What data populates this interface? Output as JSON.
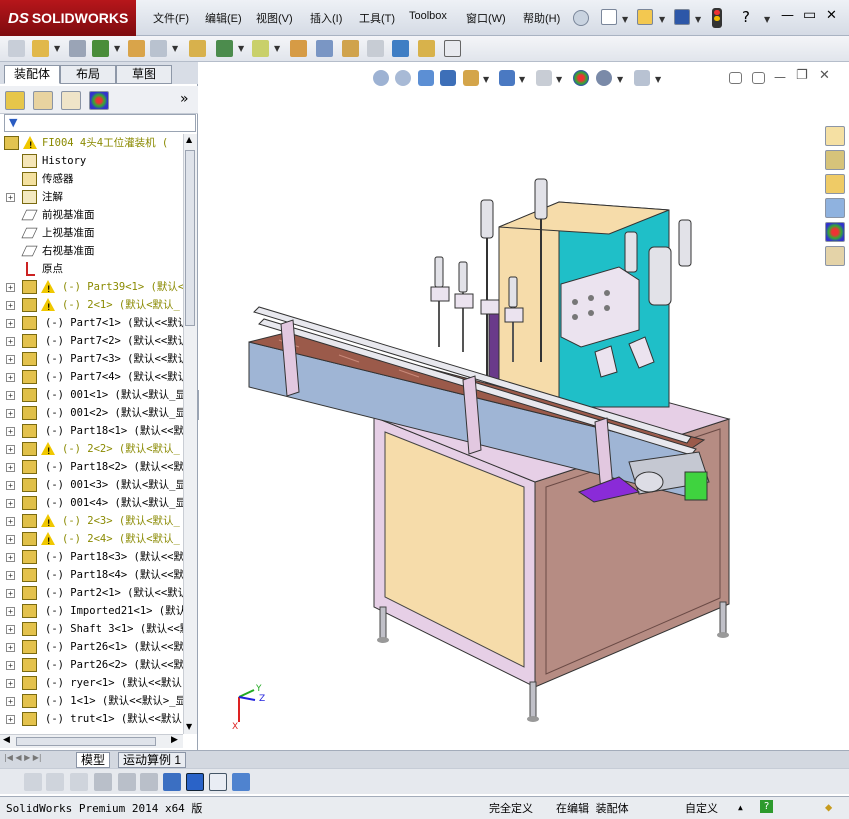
{
  "app": {
    "title": "SOLIDWORKS",
    "logo_prefix": "DS"
  },
  "menu": {
    "items": [
      "文件(F)",
      "编辑(E)",
      "视图(V)",
      "插入(I)",
      "工具(T)",
      "Toolbox",
      "窗口(W)",
      "帮助(H)"
    ]
  },
  "window_controls": {
    "help": "?",
    "minimize": "—",
    "restore": "▭",
    "close": "✕"
  },
  "panel": {
    "tabs": [
      "装配体",
      "布局",
      "草图"
    ],
    "active_tab": 0,
    "expand_glyph": "»",
    "filter_glyph": "▼"
  },
  "tree": {
    "root": "FI004 4头4工位灌装机 (",
    "items": [
      {
        "label": "History",
        "icon": "history-icon",
        "expand": false,
        "warn": false
      },
      {
        "label": "传感器",
        "icon": "sensor-icon",
        "expand": false,
        "warn": false
      },
      {
        "label": "注解",
        "icon": "annotation-icon",
        "expand": true,
        "warn": false
      },
      {
        "label": "前视基准面",
        "icon": "plane-icon",
        "expand": false,
        "warn": false
      },
      {
        "label": "上视基准面",
        "icon": "plane-icon",
        "expand": false,
        "warn": false
      },
      {
        "label": "右视基准面",
        "icon": "plane-icon",
        "expand": false,
        "warn": false
      },
      {
        "label": "原点",
        "icon": "origin-icon",
        "expand": false,
        "warn": false
      },
      {
        "label": "(-) Part39<1> (默认<",
        "icon": "part-icon",
        "expand": true,
        "warn": true
      },
      {
        "label": "(-) 2<1> (默认<默认_",
        "icon": "assembly-icon",
        "expand": true,
        "warn": true
      },
      {
        "label": "(-) Part7<1> (默认<<默认",
        "icon": "part-icon",
        "expand": true,
        "warn": false
      },
      {
        "label": "(-) Part7<2> (默认<<默认",
        "icon": "part-icon",
        "expand": true,
        "warn": false
      },
      {
        "label": "(-) Part7<3> (默认<<默认",
        "icon": "part-icon",
        "expand": true,
        "warn": false
      },
      {
        "label": "(-) Part7<4> (默认<<默认",
        "icon": "part-icon",
        "expand": true,
        "warn": false
      },
      {
        "label": "(-) 001<1> (默认<默认_显",
        "icon": "assembly-icon",
        "expand": true,
        "warn": false
      },
      {
        "label": "(-) 001<2> (默认<默认_显",
        "icon": "assembly-icon",
        "expand": true,
        "warn": false
      },
      {
        "label": "(-) Part18<1> (默认<<默",
        "icon": "part-icon",
        "expand": true,
        "warn": false
      },
      {
        "label": "(-) 2<2> (默认<默认_",
        "icon": "assembly-icon",
        "expand": true,
        "warn": true
      },
      {
        "label": "(-) Part18<2> (默认<<默",
        "icon": "part-icon",
        "expand": true,
        "warn": false
      },
      {
        "label": "(-) 001<3> (默认<默认_显",
        "icon": "assembly-icon",
        "expand": true,
        "warn": false
      },
      {
        "label": "(-) 001<4> (默认<默认_显",
        "icon": "assembly-icon",
        "expand": true,
        "warn": false
      },
      {
        "label": "(-) 2<3> (默认<默认_",
        "icon": "assembly-icon",
        "expand": true,
        "warn": true
      },
      {
        "label": "(-) 2<4> (默认<默认_",
        "icon": "assembly-icon",
        "expand": true,
        "warn": true
      },
      {
        "label": "(-) Part18<3> (默认<<默",
        "icon": "part-icon",
        "expand": true,
        "warn": false
      },
      {
        "label": "(-) Part18<4> (默认<<默",
        "icon": "part-icon",
        "expand": true,
        "warn": false
      },
      {
        "label": "(-) Part2<1> (默认<<默认",
        "icon": "part-icon",
        "expand": true,
        "warn": false
      },
      {
        "label": "(-) Imported21<1> (默认",
        "icon": "part-icon",
        "expand": true,
        "warn": false
      },
      {
        "label": "(-) Shaft 3<1> (默认<<默",
        "icon": "part-icon",
        "expand": true,
        "warn": false
      },
      {
        "label": "(-) Part26<1> (默认<<默",
        "icon": "part-icon",
        "expand": true,
        "warn": false
      },
      {
        "label": "(-) Part26<2> (默认<<默",
        "icon": "part-icon",
        "expand": true,
        "warn": false
      },
      {
        "label": "(-) ryer<1> (默认<<默认",
        "icon": "part-icon",
        "expand": true,
        "warn": false
      },
      {
        "label": "(-) 1<1> (默认<<默认>_显",
        "icon": "part-icon",
        "expand": true,
        "warn": false
      },
      {
        "label": "(-) trut<1> (默认<<默认",
        "icon": "part-icon",
        "expand": true,
        "warn": false
      }
    ]
  },
  "bottom_tabs": [
    "模型",
    "运动算例 1"
  ],
  "status": {
    "product": "SolidWorks Premium 2014 x64 版",
    "state": "完全定义",
    "editing": "在编辑 装配体",
    "units": "自定义",
    "help": "?"
  },
  "triad": {
    "x": "X",
    "y": "Y",
    "z": "Z"
  },
  "colors": {
    "logo_red": "#a51219",
    "cabinet_teal": "#1fbfc8",
    "panel_peach": "#f6dcaa",
    "frame_lavender": "#e6cfe6",
    "conveyor_blue": "#9fb5d5",
    "base_brown": "#b68c83"
  }
}
